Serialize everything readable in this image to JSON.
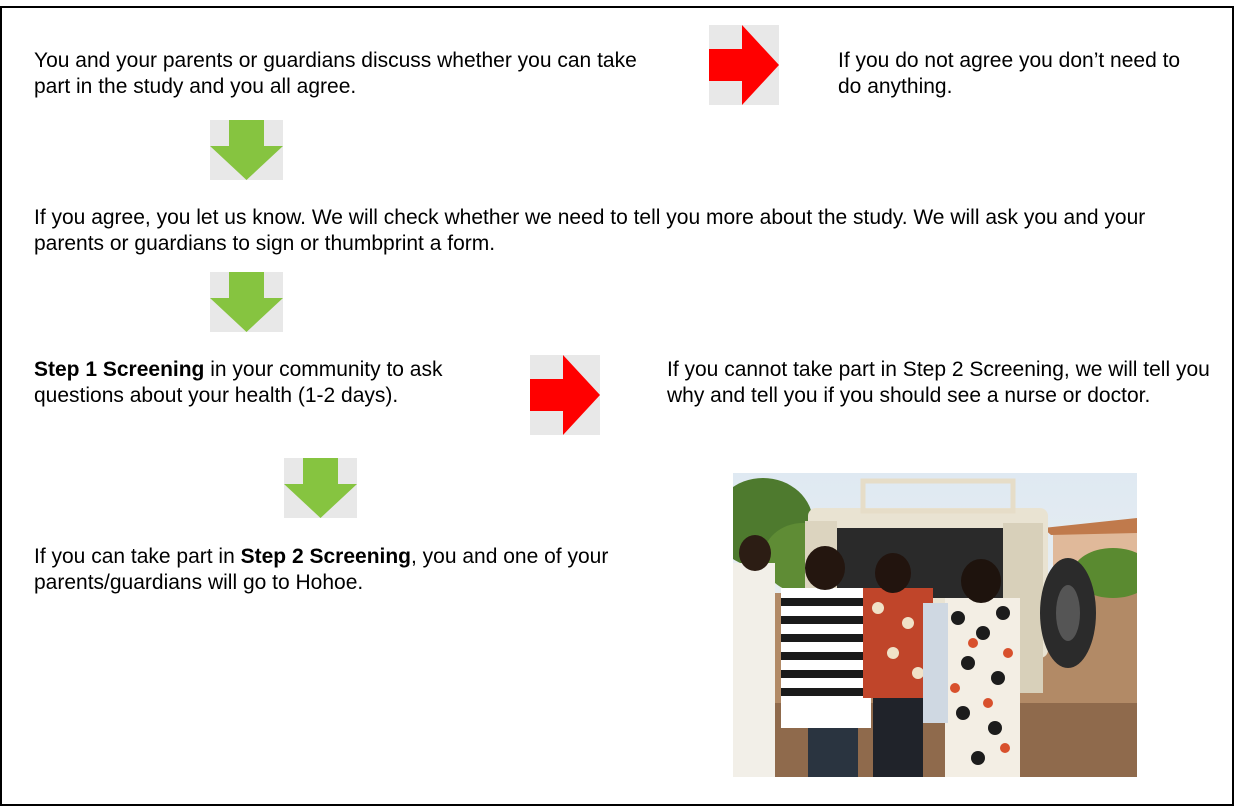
{
  "colors": {
    "red_arrow": "#ff0000",
    "green_arrow": "#86c440",
    "arrow_bg": "#e8e8e8"
  },
  "intro": {
    "left": "You and your parents or guardians discuss whether you can take part in the study and you all agree.",
    "right": "If you do not agree you don’t need to do anything."
  },
  "agree": {
    "text": "If you agree, you let us know. We will check whether we need to tell you more about the study. We will ask you and your parents or guardians to sign or thumbprint a form."
  },
  "step1": {
    "bold": "Step 1 Screening",
    "rest": " in your community to ask questions about your health (1-2 days).",
    "fail": "If you cannot take part in Step 2 Screening, we will tell you why and tell you if you should see a nurse or doctor."
  },
  "step2": {
    "prefix": "If you can take part in ",
    "bold": "Step 2 Screening",
    "suffix": ", you and one of your parents/guardians will go to Hohoe."
  },
  "icons": {
    "red": "arrow-right-icon",
    "green": "arrow-down-icon"
  }
}
